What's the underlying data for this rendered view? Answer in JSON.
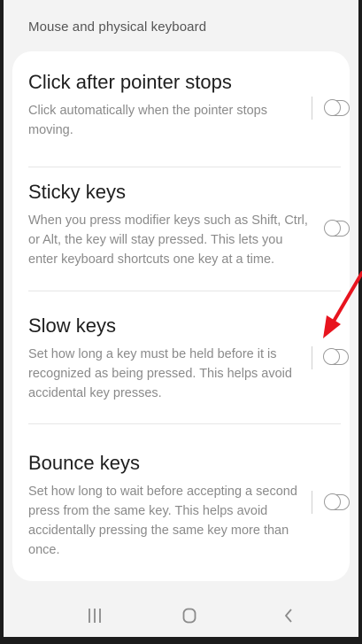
{
  "section_header": "Mouse and physical keyboard",
  "items": [
    {
      "title": "Click after pointer stops",
      "description": "Click automatically when the pointer stops moving.",
      "toggle_state": "off"
    },
    {
      "title": "Sticky keys",
      "description": "When you press modifier keys such as Shift, Ctrl, or Alt, the key will stay pressed. This lets you enter keyboard shortcuts one key at a time.",
      "toggle_state": "off"
    },
    {
      "title": "Slow keys",
      "description": "Set how long a key must be held before it is recognized as being pressed. This helps avoid accidental key presses.",
      "toggle_state": "off"
    },
    {
      "title": "Bounce keys",
      "description": "Set how long to wait before accepting a second press from the same key. This helps avoid accidentally pressing the same key more than once.",
      "toggle_state": "off"
    }
  ],
  "navbar": {
    "recent_icon": "recent-apps-icon",
    "home_icon": "home-icon",
    "back_icon": "back-icon"
  },
  "colors": {
    "annotation_arrow": "#e8141e",
    "background": "#f3f3f3",
    "card": "#ffffff"
  }
}
